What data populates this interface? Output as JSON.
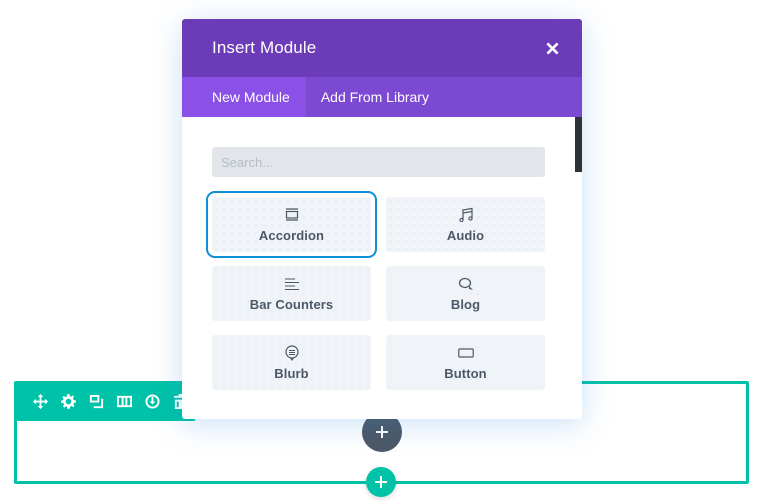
{
  "modal": {
    "title": "Insert Module",
    "close_icon": "close-icon",
    "tabs": [
      {
        "label": "New Module",
        "active": true
      },
      {
        "label": "Add From Library",
        "active": false
      }
    ],
    "search": {
      "placeholder": "Search...",
      "value": ""
    },
    "modules": [
      {
        "label": "Accordion",
        "icon": "accordion-icon",
        "selected": true
      },
      {
        "label": "Audio",
        "icon": "music-note-icon",
        "selected": false
      },
      {
        "label": "Bar Counters",
        "icon": "bar-lines-icon",
        "selected": false
      },
      {
        "label": "Blog",
        "icon": "chat-bubbles-icon",
        "selected": false
      },
      {
        "label": "Blurb",
        "icon": "speech-bubble-icon",
        "selected": false
      },
      {
        "label": "Button",
        "icon": "button-rect-icon",
        "selected": false
      }
    ]
  },
  "row_toolbar": {
    "icons": [
      "move-icon",
      "gear-icon",
      "duplicate-icon",
      "columns-icon",
      "save-to-library-icon",
      "trash-icon"
    ]
  },
  "colors": {
    "header": "#6c3bb8",
    "tabs_bar": "#7b49d2",
    "active_tab": "#8b50e6",
    "row_accent": "#00c2a8",
    "selected_outline": "#0c90d6",
    "add_module_button": "#4c5866"
  }
}
